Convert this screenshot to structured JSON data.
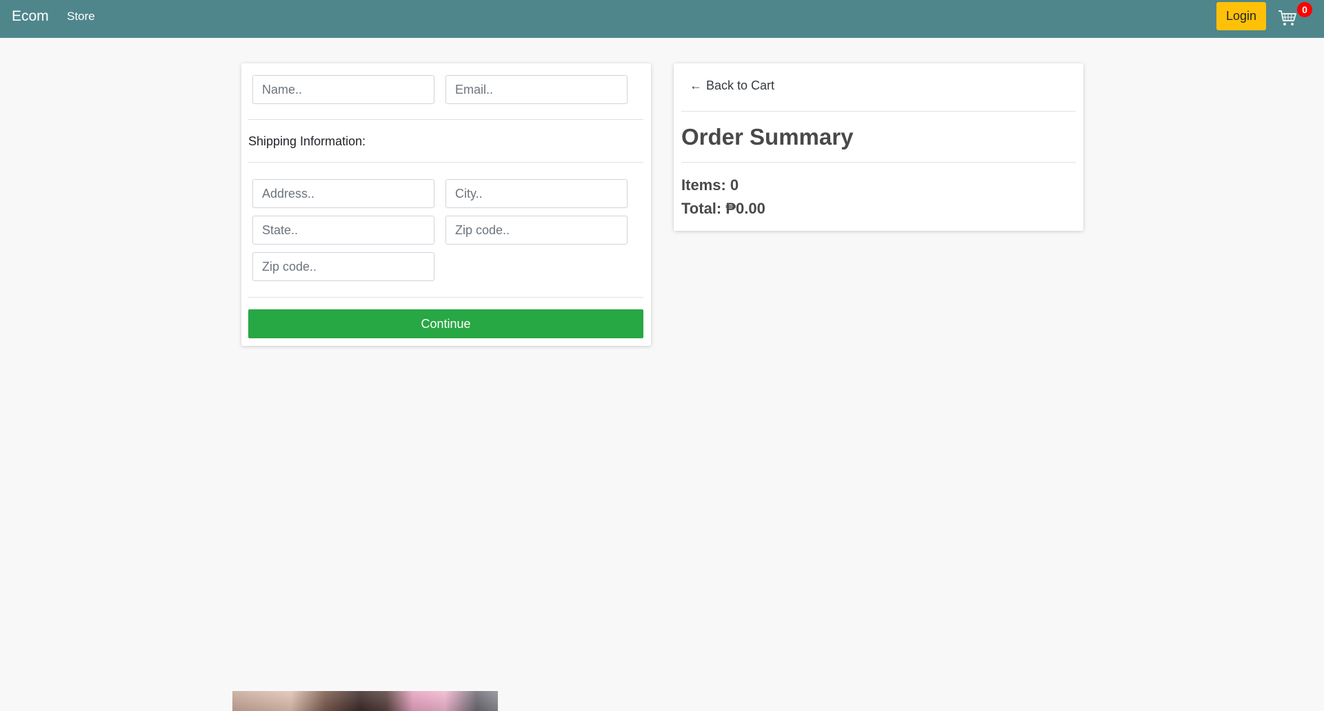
{
  "navbar": {
    "brand": "Ecom",
    "store_link": "Store",
    "login_label": "Login",
    "cart_count": "0",
    "cart_icon": "cart-icon",
    "bg_color": "#4f868c"
  },
  "form": {
    "name_placeholder": "Name..",
    "email_placeholder": "Email..",
    "shipping_heading": "Shipping Information:",
    "address_placeholder": "Address..",
    "city_placeholder": "City..",
    "state_placeholder": "State..",
    "zip_placeholder": "Zip code..",
    "zip2_placeholder": "Zip code..",
    "continue_label": "Continue",
    "continue_color": "#28a745"
  },
  "summary": {
    "back_arrow": "←",
    "back_label": "Back to Cart",
    "title": "Order Summary",
    "items_label": "Items: 0",
    "total_label": "Total: ₱0.00"
  },
  "colors": {
    "login": "#ffc107",
    "badge": "#ff0000",
    "page_bg": "#f8f8f8"
  }
}
